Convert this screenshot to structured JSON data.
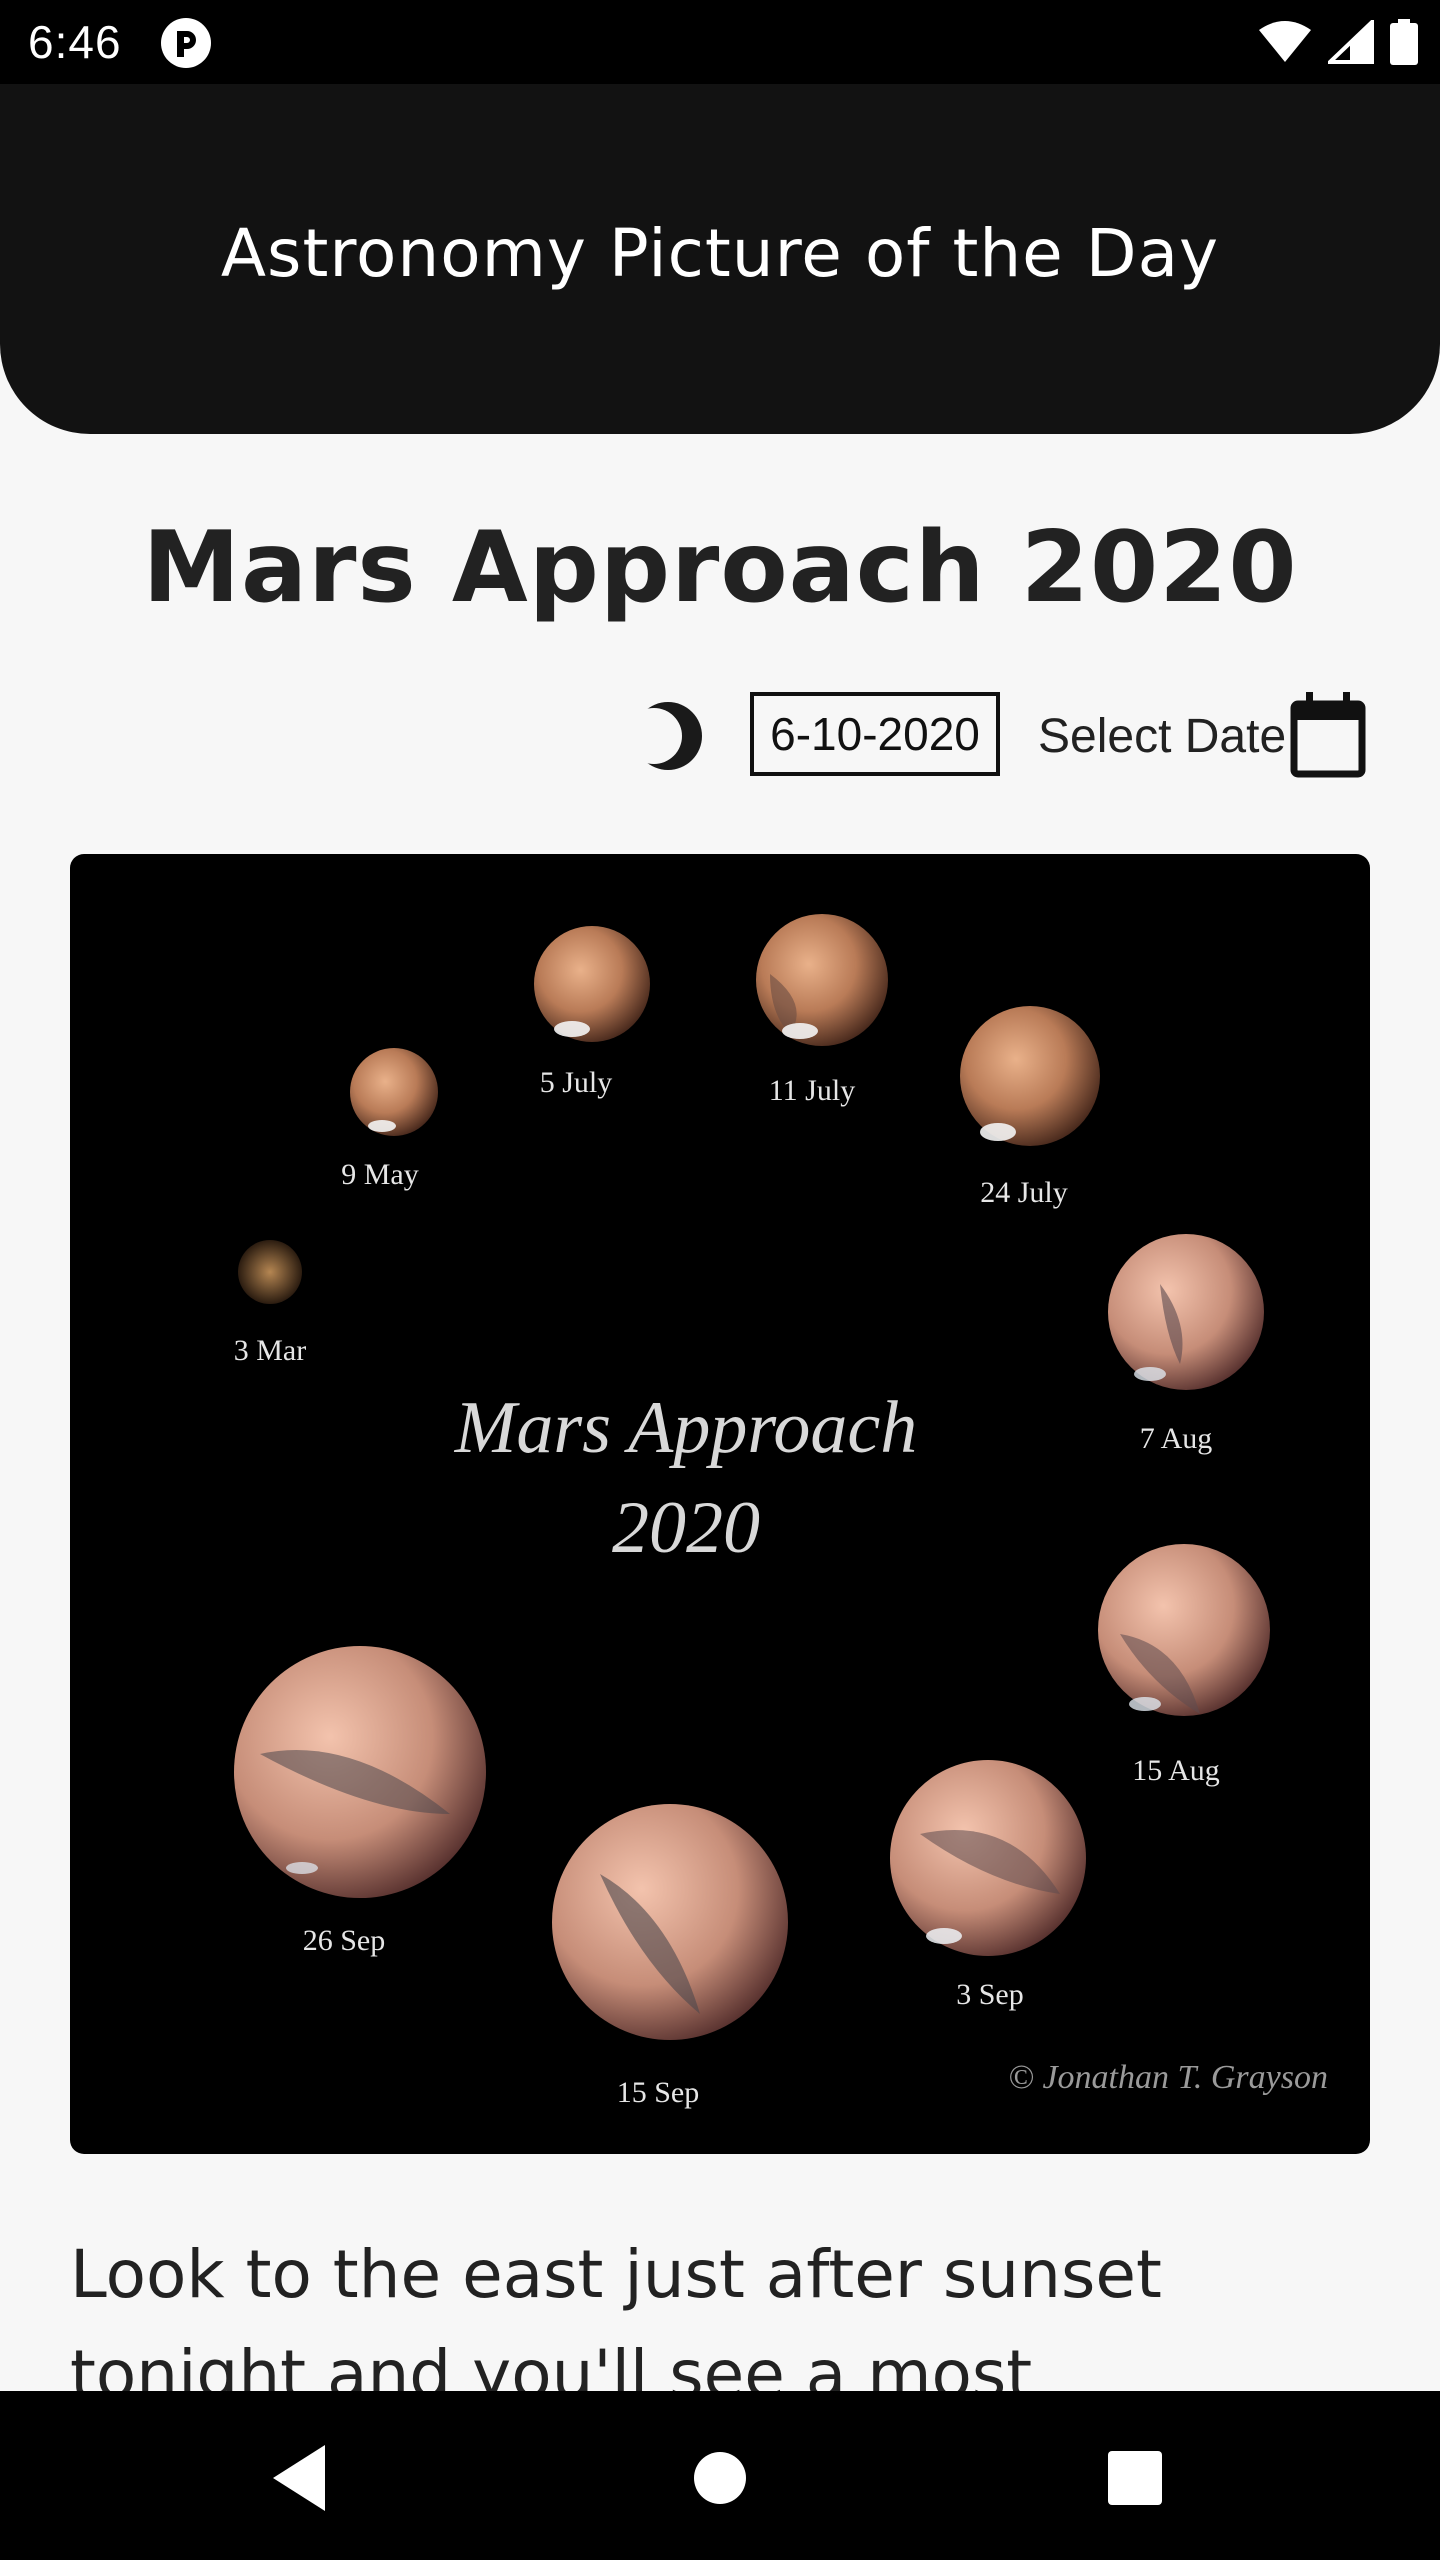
{
  "status_bar": {
    "time": "6:46",
    "app_icon": "app-notification-icon",
    "wifi_icon": "wifi-icon",
    "signal_icon": "cell-signal-icon",
    "battery_icon": "battery-icon"
  },
  "header": {
    "title": "Astronomy Picture of the Day"
  },
  "picture": {
    "title": "Mars Approach 2020",
    "date": "6-10-2020",
    "select_date_label": "Select Date",
    "theme_icon": "moon-icon",
    "calendar_icon": "calendar-icon",
    "image": {
      "heading_line1": "Mars Approach",
      "heading_line2": "2020",
      "credit": "© Jonathan T. Grayson",
      "labels": [
        "3 Mar",
        "9 May",
        "5 July",
        "11 July",
        "24 July",
        "7 Aug",
        "15 Aug",
        "3 Sep",
        "15 Sep",
        "26 Sep"
      ]
    },
    "description": "Look to the east just after sunset tonight and you'll see a most"
  },
  "nav_bar": {
    "back_icon": "back-triangle-icon",
    "home_icon": "home-circle-icon",
    "recents_icon": "recents-square-icon"
  },
  "colors": {
    "header_bg": "#121212",
    "page_bg": "#f7f7f7",
    "text_dark": "#222222",
    "mars_orange": "#c98c5a"
  }
}
